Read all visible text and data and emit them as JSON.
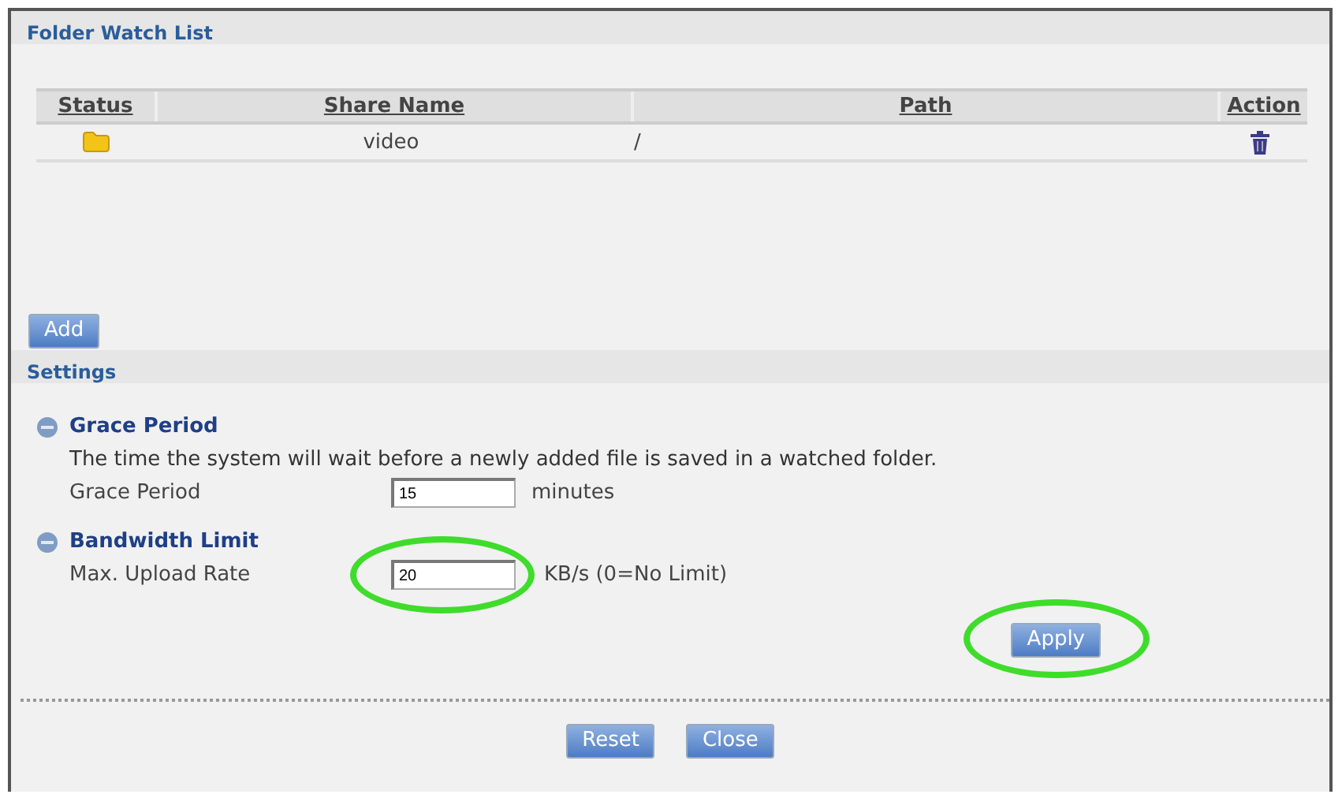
{
  "folder_watch_list": {
    "title": "Folder Watch List",
    "table": {
      "columns": [
        "Status",
        "Share Name",
        "Path",
        "Action"
      ],
      "rows": [
        {
          "share_name": "video",
          "path": "/"
        }
      ]
    },
    "add_button": "Add"
  },
  "settings": {
    "title": "Settings",
    "sections": [
      {
        "title": "Grace Period",
        "description": "The time the system will wait before a newly added file is saved in a watched folder.",
        "field": {
          "label": "Grace Period",
          "value": "15",
          "unit": "minutes",
          "highlighted": false
        }
      },
      {
        "title": "Bandwidth Limit",
        "field": {
          "label": "Max. Upload Rate",
          "value": "20",
          "unit": "KB/s (0=No Limit)",
          "highlighted": true
        }
      }
    ],
    "apply_button": {
      "label": "Apply",
      "highlighted": true
    }
  },
  "buttons": [
    "Reset",
    "Close"
  ]
}
